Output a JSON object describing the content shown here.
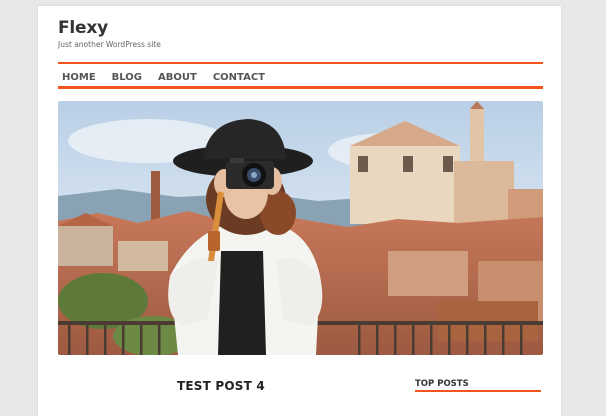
{
  "site": {
    "title": "Flexy",
    "tagline": "Just another WordPress site"
  },
  "nav": {
    "items": [
      {
        "label": "HOME"
      },
      {
        "label": "BLOG"
      },
      {
        "label": "ABOUT"
      },
      {
        "label": "CONTACT"
      }
    ]
  },
  "hero": {
    "image": "photographer-woman-with-camera-rooftops"
  },
  "post": {
    "title": "TEST POST 4"
  },
  "sidebar": {
    "widget_title": "TOP POSTS"
  },
  "colors": {
    "accent": "#f2541b",
    "background": "#e8e8e8",
    "page": "#ffffff"
  }
}
